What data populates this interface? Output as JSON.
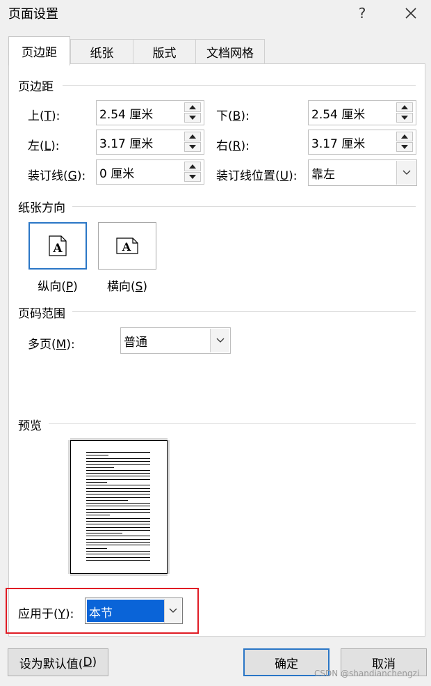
{
  "window": {
    "title": "页面设置",
    "help": "?",
    "close_icon": "close-icon"
  },
  "tabs": [
    {
      "label": "页边距",
      "active": true
    },
    {
      "label": "纸张",
      "active": false
    },
    {
      "label": "版式",
      "active": false
    },
    {
      "label": "文档网格",
      "active": false
    }
  ],
  "margins": {
    "section_title": "页边距",
    "top": {
      "label_pre": "上(",
      "key": "T",
      "label_post": "):",
      "value": "2.54 厘米"
    },
    "bottom": {
      "label_pre": "下(",
      "key": "B",
      "label_post": "):",
      "value": "2.54 厘米"
    },
    "left": {
      "label_pre": "左(",
      "key": "L",
      "label_post": "):",
      "value": "3.17 厘米"
    },
    "right": {
      "label_pre": "右(",
      "key": "R",
      "label_post": "):",
      "value": "3.17 厘米"
    },
    "gutter": {
      "label_pre": "装订线(",
      "key": "G",
      "label_post": "):",
      "value": "0 厘米"
    },
    "gutter_position": {
      "label_pre": "装订线位置(",
      "key": "U",
      "label_post": "):",
      "value": "靠左"
    }
  },
  "orientation": {
    "section_title": "纸张方向",
    "portrait": {
      "label_pre": "纵向(",
      "key": "P",
      "label_post": ")",
      "selected": true,
      "glyph": "A"
    },
    "landscape": {
      "label_pre": "横向(",
      "key": "S",
      "label_post": ")",
      "selected": false,
      "glyph": "A"
    }
  },
  "pages": {
    "section_title": "页码范围",
    "multiple": {
      "label_pre": "多页(",
      "key": "M",
      "label_post": "):",
      "value": "普通"
    }
  },
  "preview": {
    "section_title": "预览"
  },
  "apply": {
    "label_pre": "应用于(",
    "key": "Y",
    "label_post": "):",
    "value": "本节"
  },
  "buttons": {
    "default": {
      "label_pre": "设为默认值(",
      "key": "D",
      "label_post": ")"
    },
    "ok": "确定",
    "cancel": "取消"
  },
  "watermark": "CSDN @shandianchengzi",
  "colors": {
    "selection": "#0a64d8",
    "focus_border": "#2a76c6",
    "highlight": "#e01b24"
  }
}
